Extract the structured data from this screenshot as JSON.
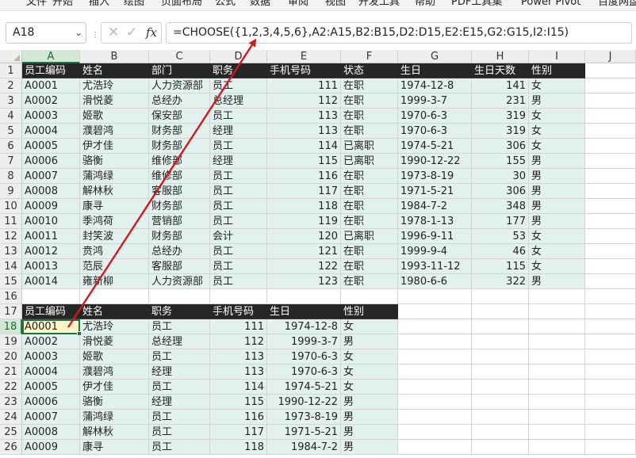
{
  "ribbon": {
    "tabs": [
      "文件",
      "开始",
      "插入",
      "绘图",
      "页面布局",
      "公式",
      "数据",
      "审阅",
      "视图",
      "开发工具",
      "帮助",
      "PDF工具集",
      "Power Pivot",
      "百度网盘"
    ]
  },
  "formula_bar": {
    "name_box": "A18",
    "formula": "=CHOOSE({1,2,3,4,5,6},A2:A15,B2:B15,D2:D15,E2:E15,G2:G15,I2:I15)",
    "icons": [
      "cancel-icon",
      "enter-icon",
      "fx-icon"
    ]
  },
  "columns": [
    "A",
    "B",
    "C",
    "D",
    "E",
    "F",
    "G",
    "H",
    "I",
    "J"
  ],
  "selected_column": "A",
  "rows": [
    "1",
    "2",
    "3",
    "4",
    "5",
    "6",
    "7",
    "8",
    "9",
    "10",
    "11",
    "12",
    "13",
    "14",
    "15",
    "16",
    "17",
    "18",
    "19",
    "20",
    "21",
    "22",
    "23",
    "24",
    "25",
    "26"
  ],
  "selected_row": "18",
  "source_table": {
    "headers": [
      "员工编码",
      "姓名",
      "部门",
      "职务",
      "手机号码",
      "状态",
      "生日",
      "生日天数",
      "性别"
    ],
    "rows": [
      [
        "A0001",
        "尤浩玲",
        "人力资源部",
        "员工",
        "111",
        "在职",
        "1974-12-8",
        "141",
        "女"
      ],
      [
        "A0002",
        "滑悦菱",
        "总经办",
        "总经理",
        "112",
        "在职",
        "1999-3-7",
        "231",
        "男"
      ],
      [
        "A0003",
        "姬歌",
        "保安部",
        "员工",
        "113",
        "在职",
        "1970-6-3",
        "319",
        "女"
      ],
      [
        "A0004",
        "濮碧鸿",
        "财务部",
        "经理",
        "113",
        "在职",
        "1970-6-3",
        "319",
        "女"
      ],
      [
        "A0005",
        "伊才佳",
        "财务部",
        "员工",
        "114",
        "已离职",
        "1974-5-21",
        "306",
        "女"
      ],
      [
        "A0006",
        "骆衡",
        "维修部",
        "经理",
        "115",
        "已离职",
        "1990-12-22",
        "155",
        "男"
      ],
      [
        "A0007",
        "蒲鸿绿",
        "维修部",
        "员工",
        "116",
        "在职",
        "1973-8-19",
        "30",
        "男"
      ],
      [
        "A0008",
        "解林秋",
        "客服部",
        "员工",
        "117",
        "在职",
        "1971-5-21",
        "306",
        "男"
      ],
      [
        "A0009",
        "康寻",
        "财务部",
        "员工",
        "118",
        "在职",
        "1984-7-2",
        "348",
        "男"
      ],
      [
        "A0010",
        "季鸿荷",
        "营销部",
        "员工",
        "119",
        "在职",
        "1978-1-13",
        "177",
        "男"
      ],
      [
        "A0011",
        "封笑波",
        "财务部",
        "会计",
        "120",
        "已离职",
        "1996-9-11",
        "53",
        "女"
      ],
      [
        "A0012",
        "贲鸿",
        "总经办",
        "员工",
        "121",
        "在职",
        "1999-9-4",
        "46",
        "女"
      ],
      [
        "A0013",
        "范辰",
        "客服部",
        "员工",
        "122",
        "在职",
        "1993-11-12",
        "115",
        "女"
      ],
      [
        "A0014",
        "雍新柳",
        "人力资源部",
        "员工",
        "123",
        "在职",
        "1980-6-6",
        "322",
        "男"
      ]
    ]
  },
  "result_table": {
    "headers": [
      "员工编码",
      "姓名",
      "职务",
      "手机号码",
      "生日",
      "性别"
    ],
    "rows": [
      [
        "A0001",
        "尤浩玲",
        "员工",
        "111",
        "1974-12-8",
        "女"
      ],
      [
        "A0002",
        "滑悦菱",
        "总经理",
        "112",
        "1999-3-7",
        "男"
      ],
      [
        "A0003",
        "姬歌",
        "员工",
        "113",
        "1970-6-3",
        "女"
      ],
      [
        "A0004",
        "濮碧鸿",
        "经理",
        "113",
        "1970-6-3",
        "女"
      ],
      [
        "A0005",
        "伊才佳",
        "员工",
        "114",
        "1974-5-21",
        "女"
      ],
      [
        "A0006",
        "骆衡",
        "经理",
        "115",
        "1990-12-22",
        "男"
      ],
      [
        "A0007",
        "蒲鸿绿",
        "员工",
        "116",
        "1973-8-19",
        "男"
      ],
      [
        "A0008",
        "解林秋",
        "员工",
        "117",
        "1971-5-21",
        "男"
      ],
      [
        "A0009",
        "康寻",
        "员工",
        "118",
        "1984-7-2",
        "男"
      ]
    ]
  },
  "annotation": {
    "color": "#d0191f",
    "from": "A18",
    "to": "formula_bar"
  },
  "colors": {
    "header_bg": "#262626",
    "data_bg": "#e3f1ee",
    "selection": "#217346",
    "active_fill": "#fef3c7"
  }
}
